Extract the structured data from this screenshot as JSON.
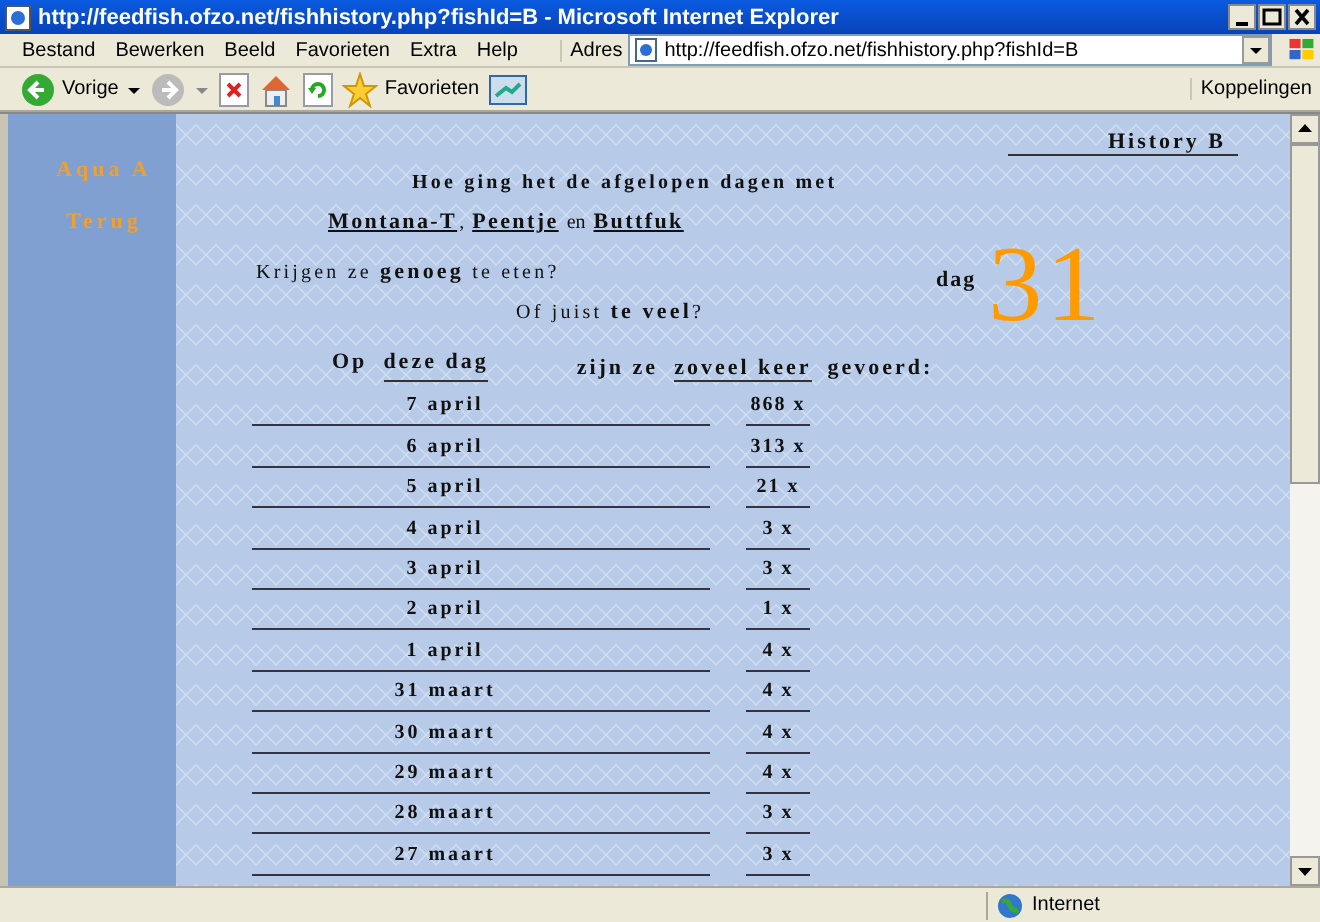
{
  "window": {
    "title": "http://feedfish.ofzo.net/fishhistory.php?fishId=B - Microsoft Internet Explorer"
  },
  "menu": [
    "Bestand",
    "Bewerken",
    "Beeld",
    "Favorieten",
    "Extra",
    "Help"
  ],
  "address": {
    "label": "Adres",
    "url": "http://feedfish.ofzo.net/fishhistory.php?fishId=B"
  },
  "toolbar": {
    "back": "Vorige",
    "favorites": "Favorieten",
    "links": "Koppelingen"
  },
  "sidebar": {
    "items": [
      "Aqua A",
      "Terug"
    ]
  },
  "page": {
    "history_title": "History B",
    "intro": "Hoe ging het de afgelopen dagen met",
    "fish": [
      {
        "name": "Montana-T",
        "after": ","
      },
      {
        "name": "Peentje",
        "after": "en"
      },
      {
        "name": "Buttfuk"
      }
    ],
    "question_1": "Krijgen ze  **genoeg** te eten?",
    "question_2": "Of juist **te veel**?",
    "day_label": "dag",
    "day_number": "31",
    "header_left": {
      "prefix": "Op",
      "underlined": "deze dag"
    },
    "header_right": {
      "prefix": "zijn ze",
      "underlined": "zoveel keer",
      "suffix": "gevoerd:"
    },
    "rows": [
      {
        "date": "7 april",
        "count": "868 x"
      },
      {
        "date": "6 april",
        "count": "313 x"
      },
      {
        "date": "5 april",
        "count": "21 x"
      },
      {
        "date": "4 april",
        "count": "3 x"
      },
      {
        "date": "3 april",
        "count": "3 x"
      },
      {
        "date": "2 april",
        "count": "1 x"
      },
      {
        "date": "1 april",
        "count": "4 x"
      },
      {
        "date": "31 maart",
        "count": "4 x"
      },
      {
        "date": "30 maart",
        "count": "4 x"
      },
      {
        "date": "29 maart",
        "count": "4 x"
      },
      {
        "date": "28 maart",
        "count": "3 x"
      },
      {
        "date": "27 maart",
        "count": "3 x"
      }
    ]
  },
  "status_bar": {
    "zone": "Internet"
  }
}
